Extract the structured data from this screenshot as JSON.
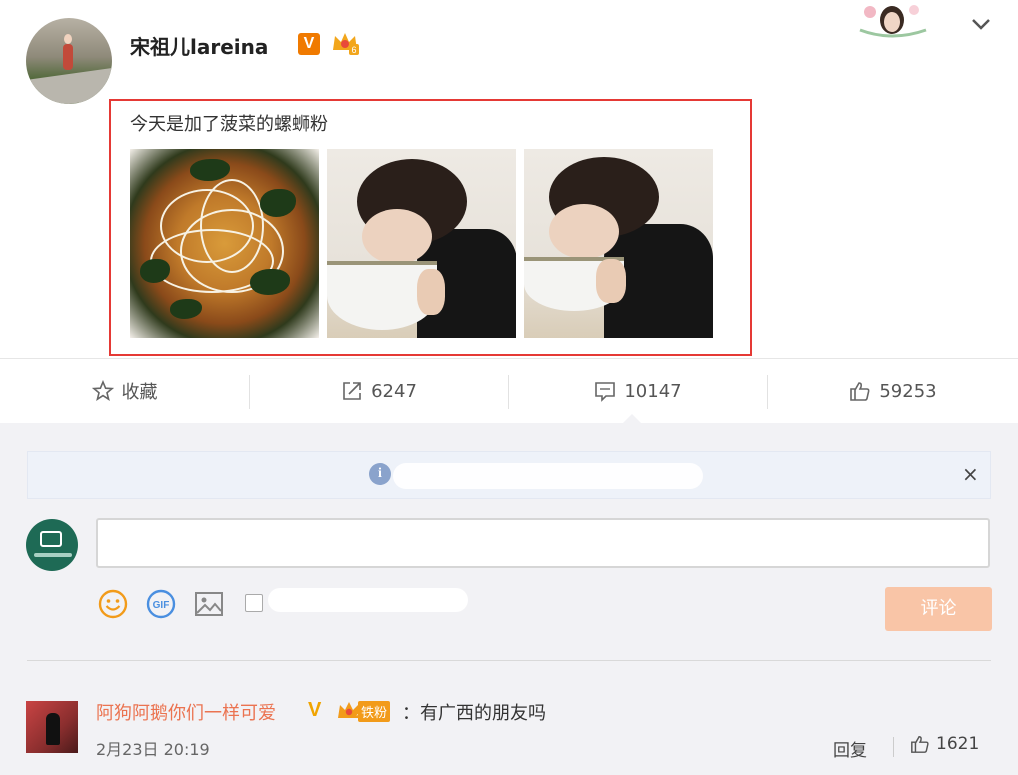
{
  "post": {
    "author": "宋祖儿lareina",
    "verified_badge": "V",
    "crown_badge_level": "6",
    "text": "今天是加了菠菜的螺蛳粉"
  },
  "actions": {
    "favorite_label": "收藏",
    "repost_count": "6247",
    "comment_count": "10147",
    "like_count": "59253"
  },
  "notice": {
    "icon": "i",
    "close": "×"
  },
  "composer": {
    "submit_label": "评论"
  },
  "comment": {
    "author": "阿狗阿鹅你们一样可爱",
    "verified_badge": "V",
    "fan_badge": "铁粉",
    "fan_level": "1",
    "text": "：有广西的朋友吗",
    "time": "2月23日 20:19",
    "reply_label": "回复",
    "like_count": "1621"
  },
  "colors": {
    "accent": "#eb7350",
    "highlight_border": "#e53935",
    "verified": "#f07a00",
    "submit_disabled": "#f9c5a7"
  }
}
